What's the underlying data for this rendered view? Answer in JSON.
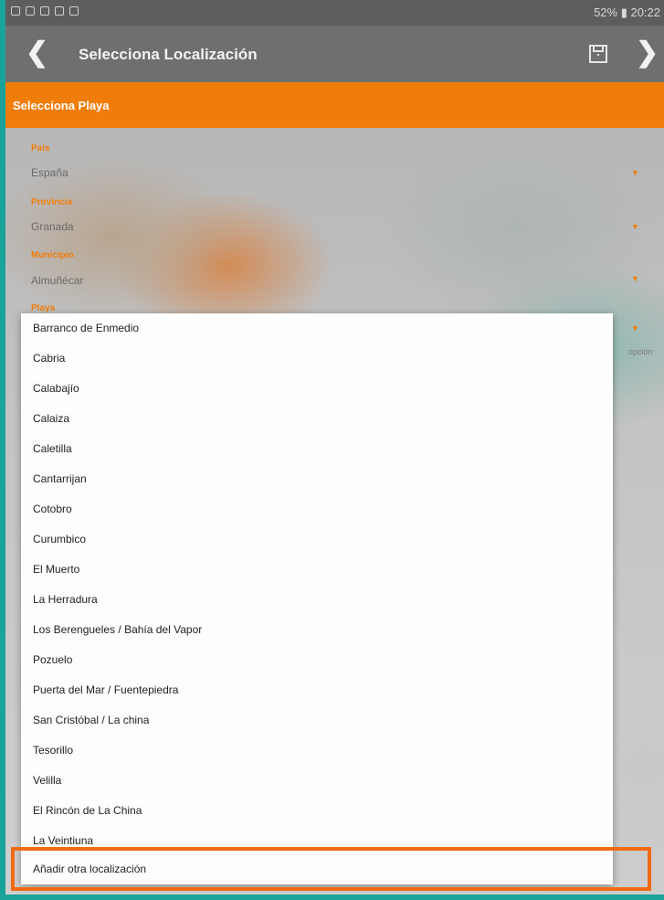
{
  "status_bar": {
    "right_text": "52% ▮ 20:22"
  },
  "toolbar": {
    "back_glyph": "❮",
    "title": "Selecciona Localización",
    "save_icon": "save-icon",
    "next_glyph": "❯"
  },
  "section": {
    "title": "Selecciona Playa"
  },
  "form": {
    "pais": {
      "label": "País",
      "value": "España"
    },
    "provincia": {
      "label": "Provincia",
      "value": "Granada"
    },
    "municipio": {
      "label": "Municipio",
      "value": "Almuñécar"
    },
    "playa": {
      "label": "Playa"
    }
  },
  "side_text": "opción",
  "dropdown": {
    "items": [
      "Barranco de Enmedio",
      "Cabria",
      "Calabajío",
      "Calaiza",
      "Caletilla",
      "Cantarrijan",
      "Cotobro",
      "Curumbico",
      "El Muerto",
      "La Herradura",
      "Los Berengueles / Bahía del Vapor",
      "Pozuelo",
      "Puerta del Mar / Fuentepiedra",
      "San Cristóbal / La china",
      "Tesorillo",
      "Velilla",
      "El Rincón de La China",
      "La Veintiuna",
      "Añadir otra localización"
    ]
  },
  "colors": {
    "accent": "#f07d0a",
    "toolbar": "#6f6f6f",
    "highlight": "#f26b14",
    "frame": "#1aa39a"
  }
}
